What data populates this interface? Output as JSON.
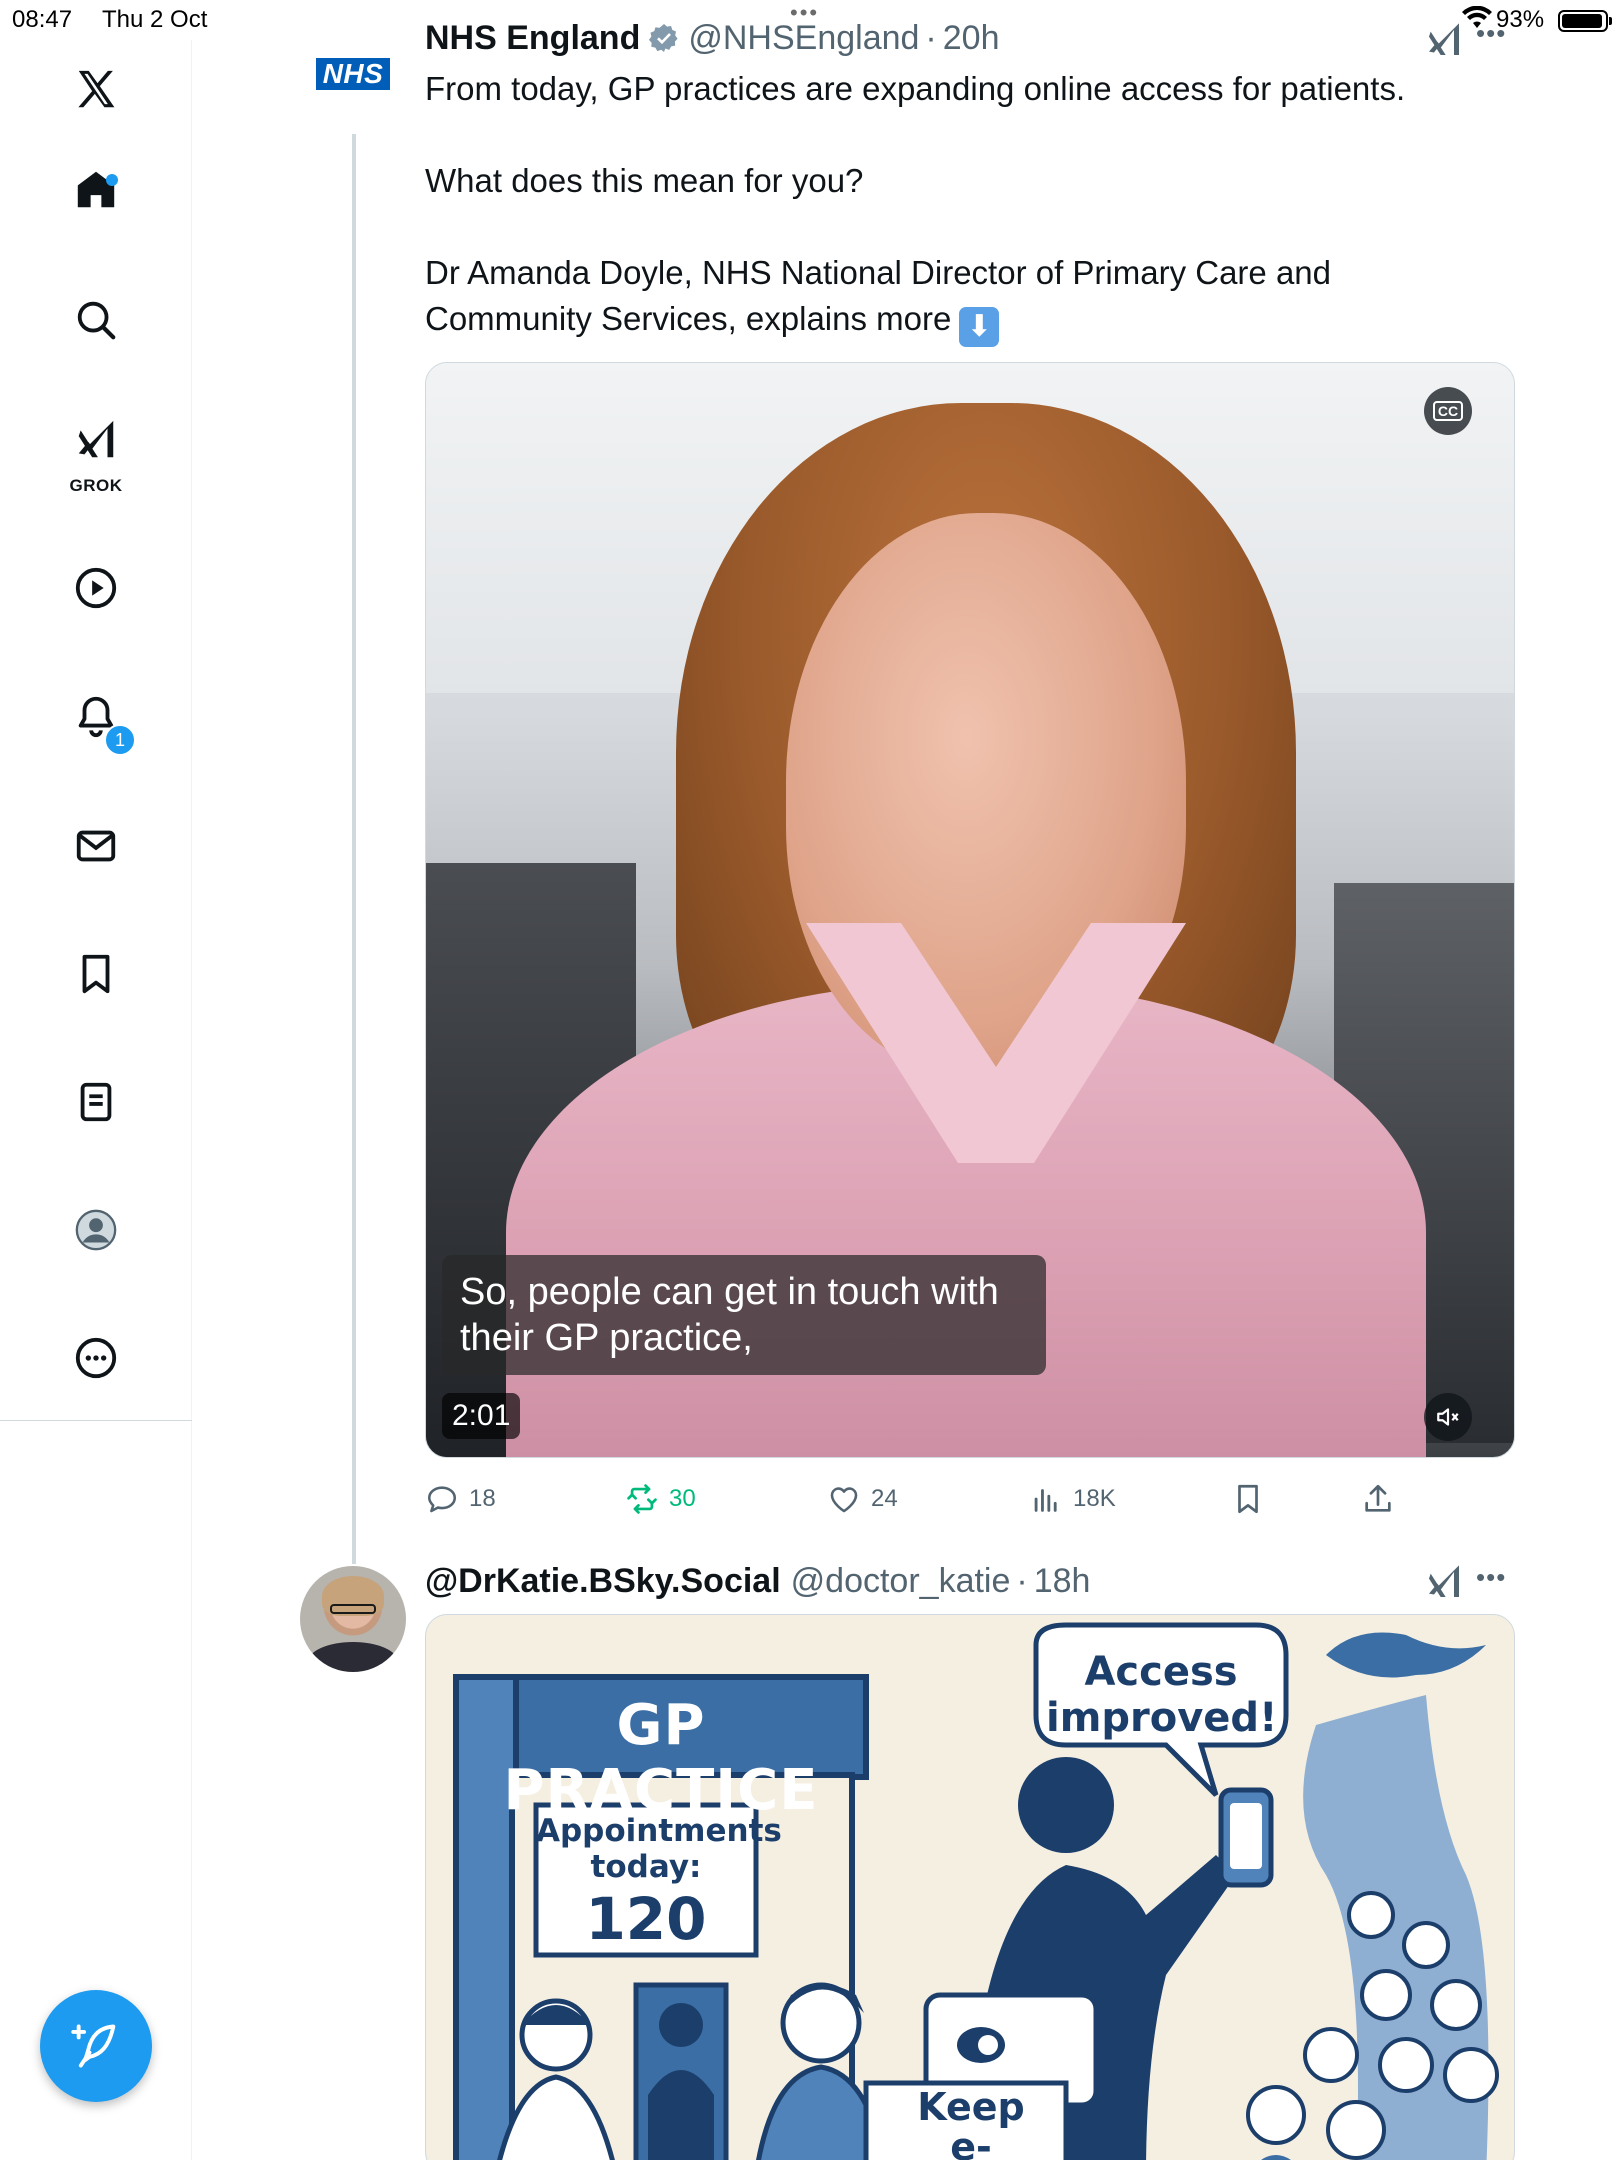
{
  "status_bar": {
    "time": "08:47",
    "date": "Thu 2 Oct",
    "battery": "93%"
  },
  "sidebar": {
    "items": [
      {
        "name": "x-logo-icon"
      },
      {
        "name": "home-icon",
        "has_dot": true
      },
      {
        "name": "search-icon"
      },
      {
        "name": "grok-icon",
        "label": "GROK"
      },
      {
        "name": "video-icon"
      },
      {
        "name": "notifications-icon",
        "badge": "1"
      },
      {
        "name": "messages-icon"
      },
      {
        "name": "bookmarks-icon"
      },
      {
        "name": "lists-icon"
      },
      {
        "name": "profile-icon"
      },
      {
        "name": "more-icon"
      }
    ],
    "compose_icon": "compose-feather-icon",
    "accent": "#1d9bf0"
  },
  "post1": {
    "avatar_text": "NHS",
    "avatar_color": "#005eb8",
    "author_name": "NHS England",
    "handle": "@NHSEngland",
    "separator": "·",
    "time": "20h",
    "text_lines": [
      "From today, GP practices are expanding online access for patients.",
      "What does this mean for you?",
      "Dr Amanda Doyle, NHS National Director of Primary Care and",
      "Community Services, explains more"
    ],
    "emoji": "⬇",
    "video": {
      "caption_line1": "So, people can get in touch with",
      "caption_line2": "their GP practice,",
      "duration": "2:01",
      "cc_label": "CC"
    },
    "actions": {
      "replies": "18",
      "reposts": "30",
      "likes": "24",
      "views": "18K"
    },
    "repost_color": "#00ba7c"
  },
  "post2": {
    "author_name": "@DrKatie.BSky.Social",
    "handle": "@doctor_katie",
    "separator": "·",
    "time": "18h",
    "image": {
      "sign_text": "GP PRACTICE",
      "appointments_label_1": "Appointments",
      "appointments_label_2": "today:",
      "appointments_count": "120",
      "bubble_line1": "Access",
      "bubble_line2": "improved!",
      "keep_line1": "Keep",
      "keep_line2": "e-consults"
    }
  }
}
